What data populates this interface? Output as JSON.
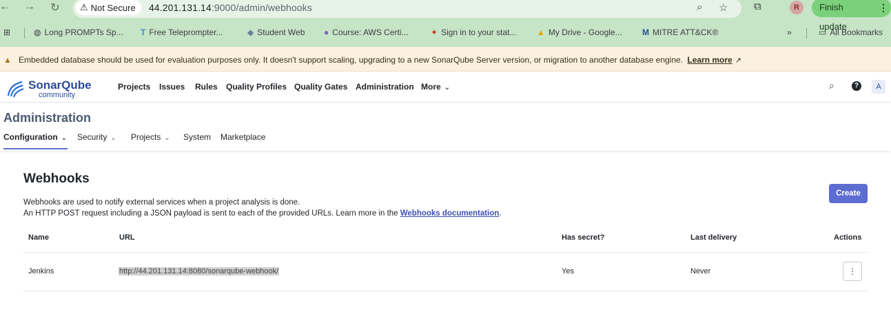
{
  "browser": {
    "back_icon": "←",
    "forward_icon": "→",
    "reload_icon": "↻",
    "security_label": "Not Secure",
    "url_host": "44.201.131.14",
    "url_rest": ":9000/admin/webhooks",
    "profile_initial": "R",
    "finish_update_label": "Finish update"
  },
  "bookmarks": {
    "items": [
      {
        "label": "Long PROMPTs Sp..."
      },
      {
        "label": "Free Teleprompter..."
      },
      {
        "label": "Student Web"
      },
      {
        "label": "Course: AWS Certi..."
      },
      {
        "label": "Sign in to your stat..."
      },
      {
        "label": "My Drive - Google..."
      },
      {
        "label": "MITRE ATT&CK®"
      }
    ],
    "overflow_label": "»",
    "all_bookmarks_label": "All Bookmarks"
  },
  "banner": {
    "message": "Embedded database should be used for evaluation purposes only. It doesn't support scaling, upgrading to a new SonarQube Server version, or migration to another database engine.",
    "learn_more": "Learn more"
  },
  "logo": {
    "brand": "SonarQube",
    "sub": "community"
  },
  "topnav": {
    "items": [
      "Projects",
      "Issues",
      "Rules",
      "Quality Profiles",
      "Quality Gates",
      "Administration",
      "More"
    ],
    "avatar_initial": "A"
  },
  "admin": {
    "title": "Administration",
    "tabs": [
      "Configuration",
      "Security",
      "Projects",
      "System",
      "Marketplace"
    ]
  },
  "webhooks": {
    "title": "Webhooks",
    "desc1": "Webhooks are used to notify external services when a project analysis is done.",
    "desc2_prefix": "An HTTP POST request including a JSON payload is sent to each of the provided URLs. Learn more in the ",
    "desc2_link": "Webhooks documentation",
    "desc2_suffix": ".",
    "create_label": "Create",
    "columns": [
      "Name",
      "URL",
      "Has secret?",
      "Last delivery",
      "Actions"
    ],
    "rows": [
      {
        "name": "Jenkins",
        "url": "http://44.201.131.14:8080/sonarqube-webhook/",
        "has_secret": "Yes",
        "last_delivery": "Never"
      }
    ]
  },
  "colors": {
    "accent": "#5d6cd1",
    "browser_bar": "#c6e4c6",
    "banner_bg": "#fbf1e0"
  }
}
